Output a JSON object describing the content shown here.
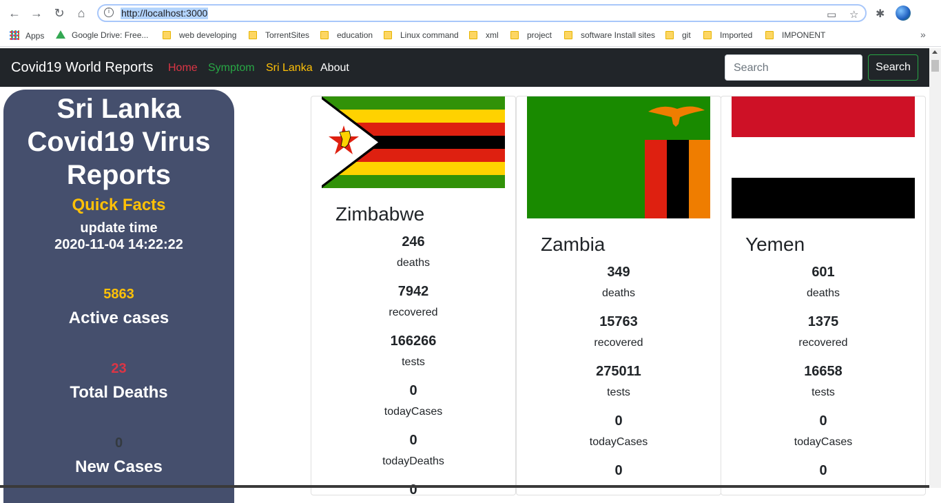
{
  "browser": {
    "url": "http://localhost:3000",
    "bookmarks": [
      "Apps",
      "Google Drive: Free...",
      "web developing",
      "TorrentSites",
      "education",
      "Linux command",
      "xml",
      "project",
      "software Install sites",
      "git",
      "Imported",
      "IMPONENT"
    ],
    "more": "»"
  },
  "navbar": {
    "brand": "Covid19 World Reports",
    "links": [
      {
        "label": "Home",
        "color": "#dc3545"
      },
      {
        "label": "Symptom",
        "color": "#28a745"
      },
      {
        "label": "Sri Lanka",
        "color": "#ffc107"
      },
      {
        "label": "About",
        "color": "#ffffff"
      }
    ],
    "search_placeholder": "Search",
    "search_button": "Search"
  },
  "sidebar": {
    "title": "Sri Lanka Covid19 Virus Reports",
    "quick_facts": "Quick Facts",
    "update_label": "update time",
    "update_time": "2020-11-04 14:22:22",
    "stats": [
      {
        "value": "5863",
        "label": "Active cases",
        "color": "#ffc107"
      },
      {
        "value": "23",
        "label": "Total Deaths",
        "color": "#dc3545"
      },
      {
        "value": "0",
        "label": "New Cases",
        "color": "#343a40"
      }
    ]
  },
  "countries": [
    {
      "name": "Zimbabwe",
      "flag": "zimbabwe-flag",
      "deaths": "246",
      "recovered": "7942",
      "tests": "166266",
      "todayCases": "0",
      "todayDeaths": "0",
      "next": "0"
    },
    {
      "name": "Zambia",
      "flag": "zambia-flag",
      "deaths": "349",
      "recovered": "15763",
      "tests": "275011",
      "todayCases": "0",
      "todayDeaths": "0"
    },
    {
      "name": "Yemen",
      "flag": "yemen-flag",
      "deaths": "601",
      "recovered": "1375",
      "tests": "16658",
      "todayCases": "0",
      "todayDeaths": "0"
    }
  ],
  "labels": {
    "deaths": "deaths",
    "recovered": "recovered",
    "tests": "tests",
    "todayCases": "todayCases",
    "todayDeaths": "todayDeaths"
  }
}
